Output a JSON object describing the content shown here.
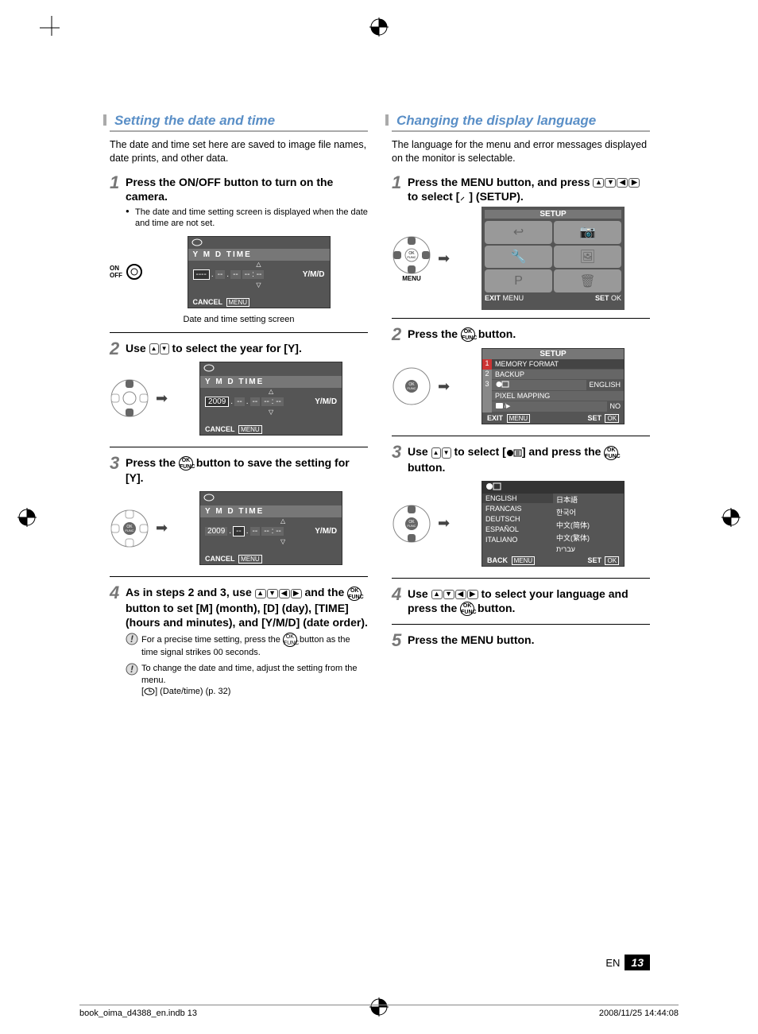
{
  "left": {
    "heading": "Setting the date and time",
    "intro": "The date and time set here are saved to image file names, date prints, and other data.",
    "step1": {
      "text": "Press the ON/OFF button to turn on the camera.",
      "onoff": "ON/OFF",
      "note": "The date and time setting screen is displayed when the date and time are not set."
    },
    "lcd1": {
      "ymd": "Y   M   D   TIME",
      "vals": [
        "----",
        "--",
        "--",
        "-- : --"
      ],
      "format": "Y/M/D",
      "cancel": "CANCEL",
      "menu": "MENU"
    },
    "caption1": "Date and time setting screen",
    "step2": {
      "text": "Use         to select the year for [Y]."
    },
    "lcd2": {
      "ymd": "Y   M   D   TIME",
      "vals": [
        "2009",
        "--",
        "--",
        "-- : --"
      ],
      "format": "Y/M/D",
      "cancel": "CANCEL",
      "menu": "MENU"
    },
    "step3": {
      "text": "Press the       button to save the setting for [Y]."
    },
    "lcd3": {
      "ymd": "Y   M   D   TIME",
      "vals": [
        "2009",
        "--",
        "--",
        "-- : --"
      ],
      "format": "Y/M/D",
      "cancel": "CANCEL",
      "menu": "MENU"
    },
    "step4": {
      "text": "As in steps 2 and 3, use              and the       button to set [M] (month), [D] (day), [TIME] (hours and minutes), and [Y/M/D] (date order)."
    },
    "tip1": "For a precise time setting, press the       button as the time signal strikes 00 seconds.",
    "tip2": "To change the date and time, adjust the setting from the menu.\n[     ] (Date/time) (p. 32)"
  },
  "right": {
    "heading": "Changing the display language",
    "intro": "The language for the menu and error messages displayed on the monitor is selectable.",
    "step1": {
      "text": "Press the MENU button, and press                to select [    ] (SETUP).",
      "menu": "MENU"
    },
    "setup_screen": {
      "title": "SETUP",
      "exit": "EXIT",
      "menu": "MENU",
      "set": "SET",
      "ok": "OK"
    },
    "step2": {
      "text": "Press the       button."
    },
    "setup_list": {
      "title": "SETUP",
      "rows": [
        {
          "n": "1",
          "t": "MEMORY FORMAT"
        },
        {
          "n": "2",
          "t": "BACKUP"
        },
        {
          "n": "3",
          "t": "",
          "r": "ENGLISH"
        },
        {
          "n": "",
          "t": "PIXEL MAPPING"
        },
        {
          "n": "",
          "t": "",
          "r": "NO"
        }
      ],
      "exit": "EXIT",
      "menu": "MENU",
      "set": "SET",
      "ok": "OK"
    },
    "step3": {
      "text": "Use         to select [      ] and press the       button."
    },
    "lang_screen": {
      "left": [
        "ENGLISH",
        "FRANCAIS",
        "DEUTSCH",
        "ESPAÑOL",
        "ITALIANO"
      ],
      "right": [
        "日本語",
        "한국어",
        "中文(简体)",
        "中文(繁体)",
        "עברית"
      ],
      "back": "BACK",
      "menu": "MENU",
      "set": "SET",
      "ok": "OK"
    },
    "step4": {
      "text": "Use                to select your language and press the       button."
    },
    "step5": {
      "text": "Press the MENU button.",
      "menu": "MENU"
    }
  },
  "footer": {
    "lang": "EN",
    "page": "13",
    "file": "book_oima_d4388_en.indb   13",
    "timestamp": "2008/11/25   14:44:08"
  }
}
